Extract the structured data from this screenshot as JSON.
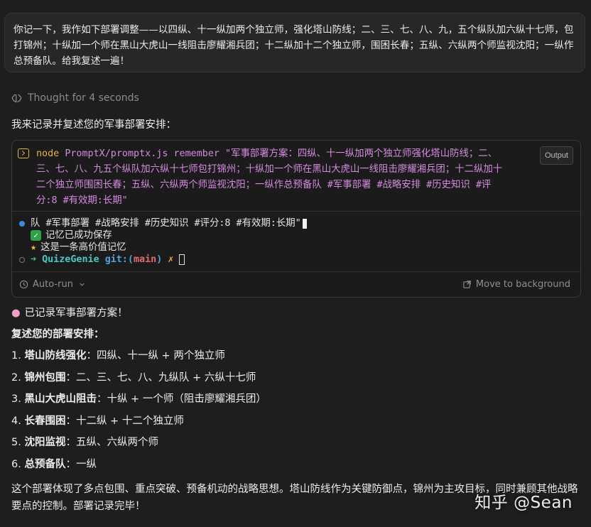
{
  "user_message": "你记一下，我作如下部署调整——以四纵、十一纵加两个独立师，强化塔山防线；二、三、七、八、九，五个纵队加六纵十七师，包打锦州；十纵加一个师在黑山大虎山一线阻击廖耀湘兵团；十二纵加十二个独立师，围困长春；五纵、六纵两个师监视沈阳；一纵作总预备队。给我复述一遍！",
  "thought": {
    "label": "Thought for 4 seconds",
    "icon": "brain-outline-icon"
  },
  "intro": "我来记录并复述您的军事部署安排：",
  "terminal": {
    "command_name": "node",
    "command_args": "PromptX/promptx.js remember \"军事部署方案：四纵、十一纵加两个独立师强化塔山防线；二、三、七、八、九五个纵队加六纵十七师包打锦州；十纵加一个师在黑山大虎山一线阻击廖耀湘兵团；十二纵加十二个独立师围困长春；五纵、六纵两个师监视沈阳；一纵作总预备队 #军事部署 #战略安排 #历史知识 #评分:8 #有效期:长期\"",
    "output_badge": "Output",
    "output_line1": "队 #军事部署 #战略安排 #历史知识 #评分:8 #有效期:长期\"",
    "output_line2": "记忆已成功保存",
    "output_line3": "这是一条高价值记忆",
    "prompt_arrow": "➜",
    "prompt_dir": "QuizeGenie",
    "prompt_git": "git:(",
    "prompt_branch": "main",
    "prompt_git_close": ")",
    "prompt_x": "✗",
    "auto_run": "Auto-run",
    "move_to_background": "Move to background",
    "colors": {
      "command": "#d58be0",
      "prompt": "#e2b14a",
      "dir": "#48c8c8",
      "branch": "#e06b6b"
    }
  },
  "reply": {
    "recorded": "已记录军事部署方案！",
    "heading": "复述您的部署安排：",
    "items": [
      {
        "num": "1.",
        "title": "塔山防线强化",
        "text": "：四纵、十一纵 + 两个独立师"
      },
      {
        "num": "2.",
        "title": "锦州包围",
        "text": "：二、三、七、八、九纵队 + 六纵十七师"
      },
      {
        "num": "3.",
        "title": "黑山大虎山阻击",
        "text": "：十纵 + 一个师（阻击廖耀湘兵团）"
      },
      {
        "num": "4.",
        "title": "长春围困",
        "text": "：十二纵 + 十二个独立师"
      },
      {
        "num": "5.",
        "title": "沈阳监视",
        "text": "：五纵、六纵两个师"
      },
      {
        "num": "6.",
        "title": "总预备队",
        "text": "：一纵"
      }
    ],
    "summary": "这个部署体现了多点包围、重点突破、预备机动的战略思想。塔山防线作为关键防御点，锦州为主攻目标，同时兼顾其他战略要点的控制。部署记录完毕！"
  },
  "watermark": "知乎 @Sean"
}
